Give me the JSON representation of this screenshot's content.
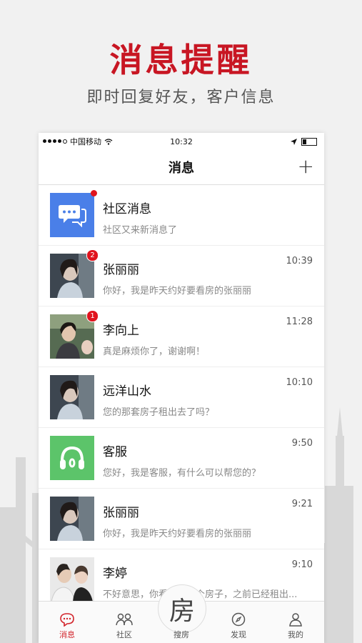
{
  "promo": {
    "headline": "消息提醒",
    "subline": "即时回复好友，客户信息"
  },
  "status_bar": {
    "carrier": "中国移动",
    "time": "10:32"
  },
  "nav": {
    "title": "消息",
    "add_symbol": "+"
  },
  "messages": [
    {
      "name": "社区消息",
      "preview": "社区又来新消息了",
      "time": "",
      "badge": "",
      "icon": "chat-bubbles-icon",
      "color": "#4a7fe8"
    },
    {
      "name": "张丽丽",
      "preview": "你好，我是昨天约好要看房的张丽丽",
      "time": "10:39",
      "badge": "2"
    },
    {
      "name": "李向上",
      "preview": "真是麻烦你了，谢谢啊！",
      "time": "11:28",
      "badge": "1"
    },
    {
      "name": "远洋山水",
      "preview": "您的那套房子租出去了吗？",
      "time": "10:10",
      "badge": ""
    },
    {
      "name": "客服",
      "preview": "您好，我是客服，有什么可以帮您的？",
      "time": "9:50",
      "badge": "",
      "icon": "headset-icon",
      "color": "#5cc46a"
    },
    {
      "name": "张丽丽",
      "preview": "你好，我是昨天约好要看房的张丽丽",
      "time": "9:21",
      "badge": ""
    },
    {
      "name": "李婷",
      "preview": "不好意思，你看上的那个房子，之前已经租出...",
      "time": "9:10",
      "badge": ""
    }
  ],
  "tabs": {
    "messages": "消息",
    "community": "社区",
    "search_glyph": "房",
    "search": "搜房",
    "discover": "发现",
    "mine": "我的"
  },
  "colors": {
    "accent": "#c81623",
    "badge": "#e0141e"
  }
}
